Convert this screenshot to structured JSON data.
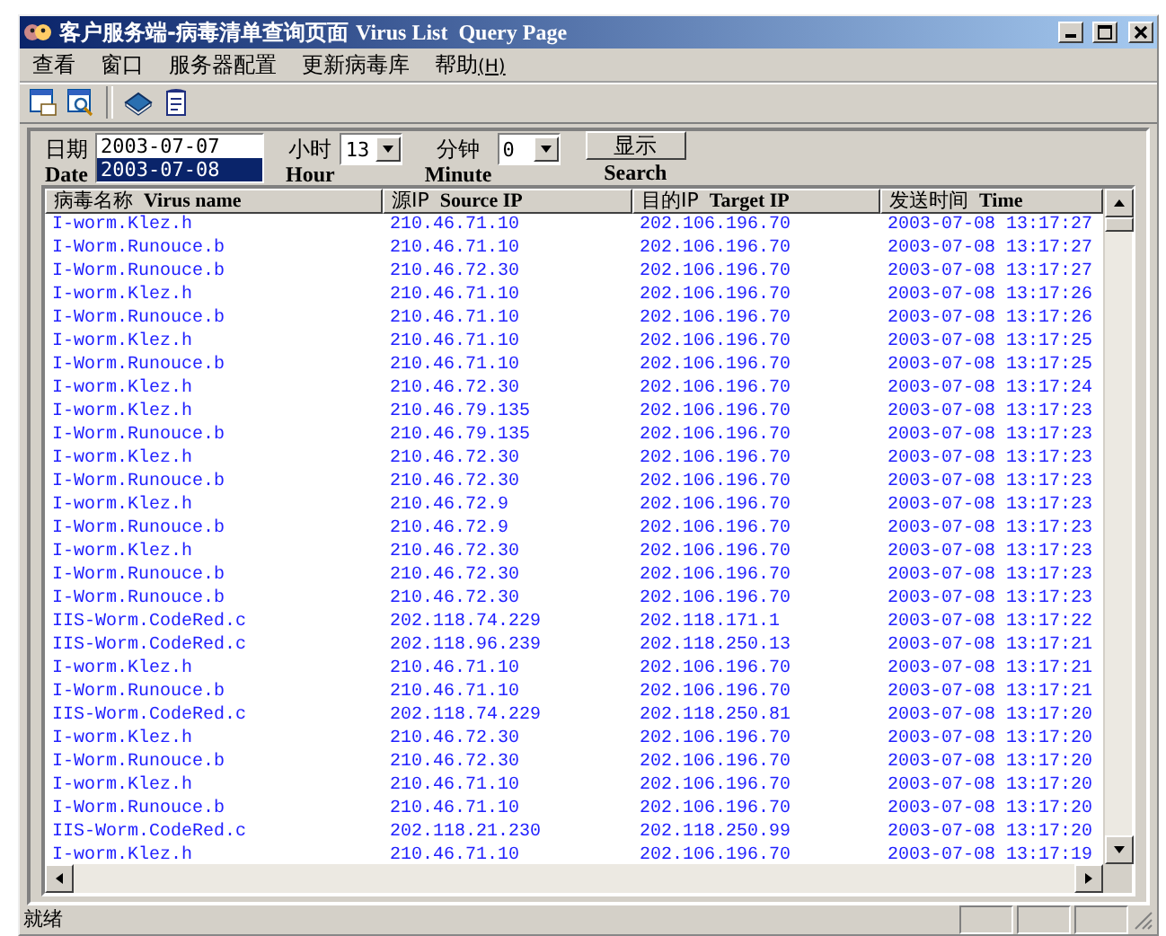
{
  "window": {
    "title_cn": "客户服务端-病毒清单查询页面",
    "title_en": "Virus List  Query Page"
  },
  "menu": [
    {
      "label": "查看"
    },
    {
      "label": "窗口"
    },
    {
      "label": "服务器配置"
    },
    {
      "label": "更新病毒库"
    },
    {
      "label": "帮助",
      "accel": "(H)"
    }
  ],
  "query": {
    "date_label": "日期",
    "date_label_en": "Date",
    "dates": [
      {
        "label": "2003-07-07",
        "selected": false
      },
      {
        "label": "2003-07-08",
        "selected": true
      }
    ],
    "hour_label": "小时",
    "hour_label_en": "Hour",
    "hour": "13",
    "minute_label": "分钟",
    "minute_label_en": "Minute",
    "minute": "0",
    "search_button": "显示",
    "search_label_en": "Search"
  },
  "table": {
    "columns": [
      {
        "cn": "病毒名称",
        "en": "Virus name"
      },
      {
        "cn": "源IP",
        "en": "Source IP"
      },
      {
        "cn": "目的IP",
        "en": "Target IP"
      },
      {
        "cn": "发送时间",
        "en": "Time"
      }
    ],
    "rows": [
      [
        "I-worm.Klez.h",
        "210.46.71.10",
        "202.106.196.70",
        "2003-07-08 13:17:27"
      ],
      [
        "I-Worm.Runouce.b",
        "210.46.71.10",
        "202.106.196.70",
        "2003-07-08 13:17:27"
      ],
      [
        "I-Worm.Runouce.b",
        "210.46.72.30",
        "202.106.196.70",
        "2003-07-08 13:17:27"
      ],
      [
        "I-worm.Klez.h",
        "210.46.71.10",
        "202.106.196.70",
        "2003-07-08 13:17:26"
      ],
      [
        "I-Worm.Runouce.b",
        "210.46.71.10",
        "202.106.196.70",
        "2003-07-08 13:17:26"
      ],
      [
        "I-worm.Klez.h",
        "210.46.71.10",
        "202.106.196.70",
        "2003-07-08 13:17:25"
      ],
      [
        "I-Worm.Runouce.b",
        "210.46.71.10",
        "202.106.196.70",
        "2003-07-08 13:17:25"
      ],
      [
        "I-worm.Klez.h",
        "210.46.72.30",
        "202.106.196.70",
        "2003-07-08 13:17:24"
      ],
      [
        "I-worm.Klez.h",
        "210.46.79.135",
        "202.106.196.70",
        "2003-07-08 13:17:23"
      ],
      [
        "I-Worm.Runouce.b",
        "210.46.79.135",
        "202.106.196.70",
        "2003-07-08 13:17:23"
      ],
      [
        "I-worm.Klez.h",
        "210.46.72.30",
        "202.106.196.70",
        "2003-07-08 13:17:23"
      ],
      [
        "I-Worm.Runouce.b",
        "210.46.72.30",
        "202.106.196.70",
        "2003-07-08 13:17:23"
      ],
      [
        "I-worm.Klez.h",
        "210.46.72.9",
        "202.106.196.70",
        "2003-07-08 13:17:23"
      ],
      [
        "I-Worm.Runouce.b",
        "210.46.72.9",
        "202.106.196.70",
        "2003-07-08 13:17:23"
      ],
      [
        "I-worm.Klez.h",
        "210.46.72.30",
        "202.106.196.70",
        "2003-07-08 13:17:23"
      ],
      [
        "I-Worm.Runouce.b",
        "210.46.72.30",
        "202.106.196.70",
        "2003-07-08 13:17:23"
      ],
      [
        "I-Worm.Runouce.b",
        "210.46.72.30",
        "202.106.196.70",
        "2003-07-08 13:17:23"
      ],
      [
        "IIS-Worm.CodeRed.c",
        "202.118.74.229",
        "202.118.171.1",
        "2003-07-08 13:17:22"
      ],
      [
        "IIS-Worm.CodeRed.c",
        "202.118.96.239",
        "202.118.250.13",
        "2003-07-08 13:17:21"
      ],
      [
        "I-worm.Klez.h",
        "210.46.71.10",
        "202.106.196.70",
        "2003-07-08 13:17:21"
      ],
      [
        "I-Worm.Runouce.b",
        "210.46.71.10",
        "202.106.196.70",
        "2003-07-08 13:17:21"
      ],
      [
        "IIS-Worm.CodeRed.c",
        "202.118.74.229",
        "202.118.250.81",
        "2003-07-08 13:17:20"
      ],
      [
        "I-worm.Klez.h",
        "210.46.72.30",
        "202.106.196.70",
        "2003-07-08 13:17:20"
      ],
      [
        "I-Worm.Runouce.b",
        "210.46.72.30",
        "202.106.196.70",
        "2003-07-08 13:17:20"
      ],
      [
        "I-worm.Klez.h",
        "210.46.71.10",
        "202.106.196.70",
        "2003-07-08 13:17:20"
      ],
      [
        "I-Worm.Runouce.b",
        "210.46.71.10",
        "202.106.196.70",
        "2003-07-08 13:17:20"
      ],
      [
        "IIS-Worm.CodeRed.c",
        "202.118.21.230",
        "202.118.250.99",
        "2003-07-08 13:17:20"
      ],
      [
        "I-worm.Klez.h",
        "210.46.71.10",
        "202.106.196.70",
        "2003-07-08 13:17:19"
      ]
    ]
  },
  "status_bar": {
    "text": "就绪"
  }
}
